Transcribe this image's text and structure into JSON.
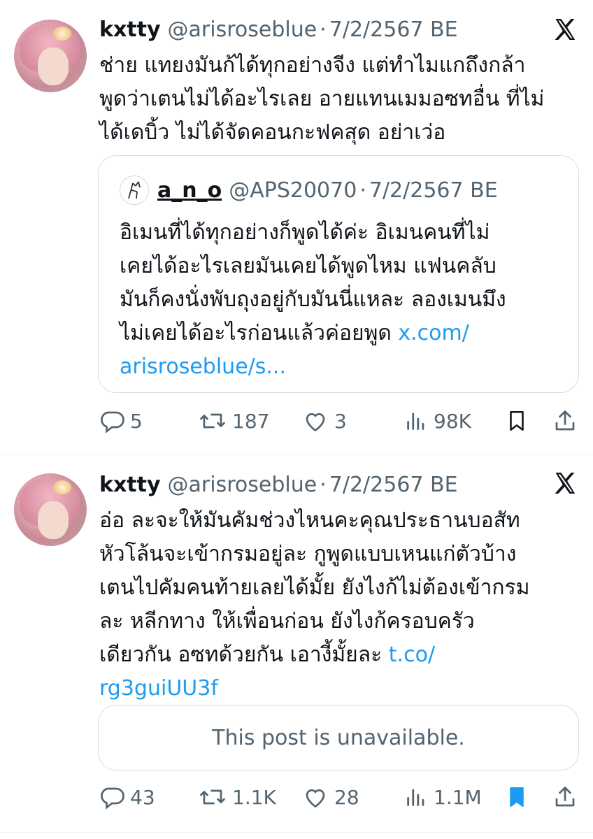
{
  "tweets": [
    {
      "name": "kxtty",
      "handle": "@arisroseblue",
      "separator": "·",
      "date": "7/2/2567 BE",
      "text": "ช่าย แทยงมันก้ได้ทุกอย่างจีง แต่ทำไมแกถึงกล้า\nพูดว่าเตนไม่ได้อะไรเลย อายแทนเมมอซทอื่น ที่ไม่\nได้เดบิ้ว ไม่ได้จัดคอนกะฟคสุด อย่าเว่อ",
      "quote": {
        "name": "a_n_o",
        "handle": "@APS20070",
        "separator": "·",
        "date": "7/2/2567 BE",
        "text": "อิเมนที่ได้ทุกอย่างก็พูดได้ค่ะ อิเมนคนที่ไม่\nเคยได้อะไรเลยมันเคยได้พูดไหม แฟนคลับ\nมันก็คงนั่งพับถุงอยู่กับมันนี่แหละ ลองเมนมึง\nไม่เคยได้อะไรก่อนแล้วค่อยพูด ",
        "link": "x.com/\narisroseblue/s..."
      },
      "actions": {
        "replies": "5",
        "reposts": "187",
        "likes": "3",
        "views": "98K",
        "bookmarked": false
      }
    },
    {
      "name": "kxtty",
      "handle": "@arisroseblue",
      "separator": "·",
      "date": "7/2/2567 BE",
      "text": "อ่อ ละจะให้มันคัมช่วงไหนคะคุณประธานบอสัท\nหัวโล้นจะเข้ากรมอยู่ละ กูพูดแบบเหนแก่ตัวบ้าง\nเตนไปคัมคนท้ายเลยได้มั้ย ยังไงก้ไม่ต้องเข้ากรม\nละ หลีกทาง ให้เพื่อนก่อน ยังไงก้ครอบครัว\nเดียวกัน อซทด้วยกัน เอางี้มั้ยละ ",
      "link": "t.co/\nrg3guiUU3f",
      "unavailable": "This post is unavailable.",
      "actions": {
        "replies": "43",
        "reposts": "1.1K",
        "likes": "28",
        "views": "1.1M",
        "bookmarked": true
      }
    }
  ],
  "icons": {
    "logo": "x-logo-icon",
    "reply": "reply-icon",
    "repost": "repost-icon",
    "like": "heart-icon",
    "views": "views-icon",
    "bookmark": "bookmark-icon",
    "share": "share-icon"
  },
  "colors": {
    "link": "#1d9bf0",
    "secondary": "#536471",
    "bookmark_active": "#1d9bf0"
  }
}
